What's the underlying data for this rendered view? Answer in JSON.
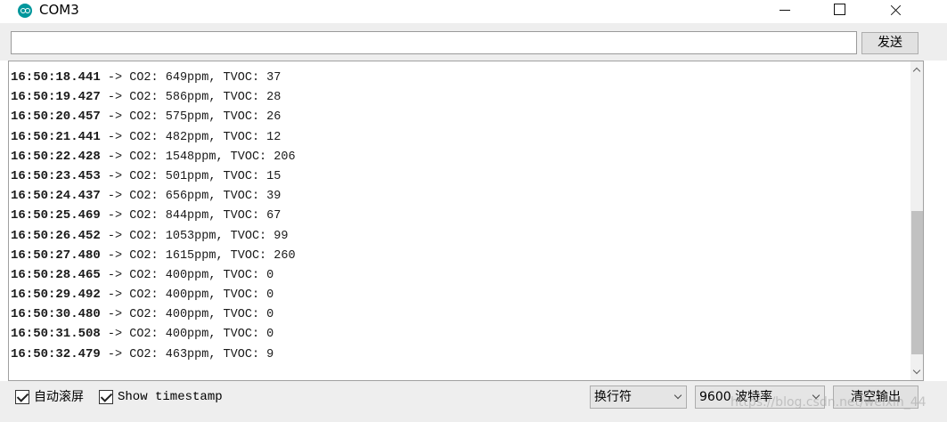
{
  "window": {
    "title": "COM3"
  },
  "input_row": {
    "input_value": "",
    "send_label": "发送"
  },
  "serial_lines": [
    {
      "time": "16:50:18.441",
      "rest": " -> CO2: 649ppm, TVOC: 37"
    },
    {
      "time": "16:50:19.427",
      "rest": " -> CO2: 586ppm, TVOC: 28"
    },
    {
      "time": "16:50:20.457",
      "rest": " -> CO2: 575ppm, TVOC: 26"
    },
    {
      "time": "16:50:21.441",
      "rest": " -> CO2: 482ppm, TVOC: 12"
    },
    {
      "time": "16:50:22.428",
      "rest": " -> CO2: 1548ppm, TVOC: 206"
    },
    {
      "time": "16:50:23.453",
      "rest": " -> CO2: 501ppm, TVOC: 15"
    },
    {
      "time": "16:50:24.437",
      "rest": " -> CO2: 656ppm, TVOC: 39"
    },
    {
      "time": "16:50:25.469",
      "rest": " -> CO2: 844ppm, TVOC: 67"
    },
    {
      "time": "16:50:26.452",
      "rest": " -> CO2: 1053ppm, TVOC: 99"
    },
    {
      "time": "16:50:27.480",
      "rest": " -> CO2: 1615ppm, TVOC: 260"
    },
    {
      "time": "16:50:28.465",
      "rest": " -> CO2: 400ppm, TVOC: 0"
    },
    {
      "time": "16:50:29.492",
      "rest": " -> CO2: 400ppm, TVOC: 0"
    },
    {
      "time": "16:50:30.480",
      "rest": " -> CO2: 400ppm, TVOC: 0"
    },
    {
      "time": "16:50:31.508",
      "rest": " -> CO2: 400ppm, TVOC: 0"
    },
    {
      "time": "16:50:32.479",
      "rest": " -> CO2: 463ppm, TVOC: 9"
    }
  ],
  "bottom_bar": {
    "autoscroll_label": "自动滚屏",
    "autoscroll_checked": true,
    "timestamp_label": "Show timestamp",
    "timestamp_checked": true,
    "line_ending": "换行符",
    "baud_rate": "9600 波特率",
    "clear_label": "清空输出"
  },
  "watermark": "https://blog.csdn.net/weixin_44"
}
